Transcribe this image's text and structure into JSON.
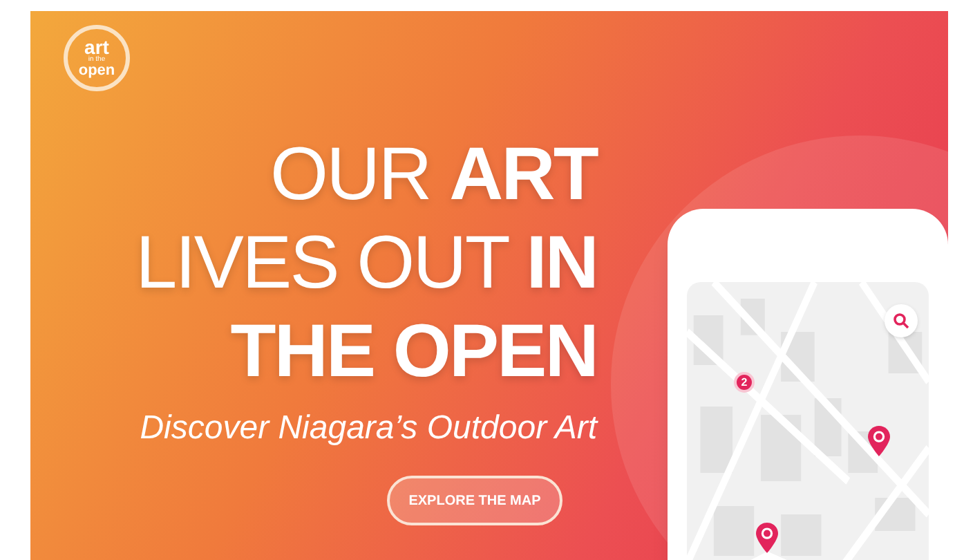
{
  "logo": {
    "lines": [
      "art",
      "in the",
      "open"
    ]
  },
  "headline": [
    "OUR **ART**",
    "LIVES OUT **IN**",
    "**THE OPEN**"
  ],
  "subtitle": "Discover Niagara’s Outdoor Art",
  "cta_button": "EXPLORE THE MAP",
  "phone": {
    "cluster_count": "2"
  }
}
